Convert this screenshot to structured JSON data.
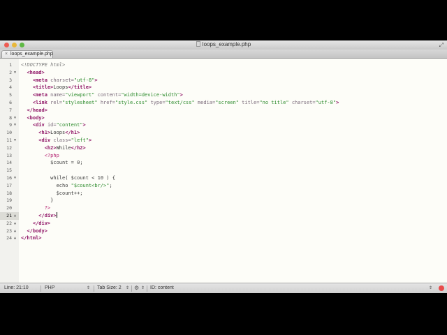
{
  "window": {
    "title": "loops_example.php",
    "tab_label": "loops_example.php"
  },
  "editor": {
    "current_line": 21,
    "lines": [
      {
        "n": "1",
        "fold": "",
        "html": "<span class=\"cm\">&lt;!DOCTYPE html&gt;</span>"
      },
      {
        "n": "2",
        "fold": "▼",
        "html": "  <span class=\"tg\">&lt;head&gt;</span>"
      },
      {
        "n": "3",
        "fold": "",
        "html": "    <span class=\"tg\">&lt;meta</span> <span class=\"at\">charset=</span><span class=\"str\">\"utf-8\"</span><span class=\"tg\">&gt;</span>"
      },
      {
        "n": "4",
        "fold": "",
        "html": "    <span class=\"tg\">&lt;title&gt;</span>Loops<span class=\"tg\">&lt;/title&gt;</span>"
      },
      {
        "n": "5",
        "fold": "",
        "html": "    <span class=\"tg\">&lt;meta</span> <span class=\"at\">name=</span><span class=\"str\">\"viewport\"</span> <span class=\"at\">content=</span><span class=\"str\">\"width=device-width\"</span><span class=\"tg\">&gt;</span>"
      },
      {
        "n": "6",
        "fold": "",
        "html": "    <span class=\"tg\">&lt;link</span> <span class=\"at\">rel=</span><span class=\"str\">\"stylesheet\"</span> <span class=\"at\">href=</span><span class=\"str\">\"style.css\"</span> <span class=\"at\">type=</span><span class=\"str\">\"text/css\"</span> <span class=\"at\">media=</span><span class=\"str\">\"screen\"</span> <span class=\"at\">title=</span><span class=\"str\">\"no title\"</span> <span class=\"at\">charset=</span><span class=\"str\">\"utf-8\"</span><span class=\"tg\">&gt;</span>"
      },
      {
        "n": "7",
        "fold": "",
        "html": "  <span class=\"tg\">&lt;/head&gt;</span>"
      },
      {
        "n": "8",
        "fold": "▼",
        "html": "  <span class=\"tg\">&lt;body&gt;</span>"
      },
      {
        "n": "9",
        "fold": "▼",
        "html": "    <span class=\"tg\">&lt;div</span> <span class=\"at\">id=</span><span class=\"str\">\"content\"</span><span class=\"tg\">&gt;</span>"
      },
      {
        "n": "10",
        "fold": "",
        "html": "      <span class=\"tg\">&lt;h1&gt;</span>Loops<span class=\"tg\">&lt;/h1&gt;</span>"
      },
      {
        "n": "11",
        "fold": "▼",
        "html": "      <span class=\"tg\">&lt;div</span> <span class=\"at\">class=</span><span class=\"str\">\"left\"</span><span class=\"tg\">&gt;</span>"
      },
      {
        "n": "12",
        "fold": "",
        "html": "        <span class=\"tg\">&lt;h2&gt;</span>While<span class=\"tg\">&lt;/h2&gt;</span>"
      },
      {
        "n": "13",
        "fold": "",
        "html": "        <span class=\"ph\">&lt;?php</span>"
      },
      {
        "n": "14",
        "fold": "",
        "html": "          <span class=\"vr\">$count</span> = <span class=\"vr\">0</span>;"
      },
      {
        "n": "15",
        "fold": "",
        "html": ""
      },
      {
        "n": "16",
        "fold": "▼",
        "html": "          <span class=\"fn\">while</span>( <span class=\"vr\">$count</span> &lt; <span class=\"vr\">10</span> ) {"
      },
      {
        "n": "17",
        "fold": "",
        "html": "            <span class=\"fn\">echo</span> <span class=\"str\">\"$count&lt;br/&gt;\"</span>;"
      },
      {
        "n": "18",
        "fold": "",
        "html": "            <span class=\"vr\">$count</span>++;"
      },
      {
        "n": "19",
        "fold": "",
        "html": "          }"
      },
      {
        "n": "20",
        "fold": "",
        "html": "        <span class=\"ph\">?&gt;</span>"
      },
      {
        "n": "21",
        "fold": "▲",
        "html": "      <span class=\"tg\">&lt;/div&gt;</span><span class=\"caret\"></span>"
      },
      {
        "n": "22",
        "fold": "▲",
        "html": "    <span class=\"tg\">&lt;/div&gt;</span>"
      },
      {
        "n": "23",
        "fold": "▲",
        "html": "  <span class=\"tg\">&lt;/body&gt;</span>"
      },
      {
        "n": "24",
        "fold": "▲",
        "html": "<span class=\"tg\">&lt;/html&gt;</span>"
      }
    ]
  },
  "status": {
    "position": "Line: 21:10",
    "syntax": "PHP",
    "tab_size": "Tab Size: 2",
    "symbol": "ID: content"
  },
  "colors": {
    "tag": "#8f1466",
    "string": "#2a8a2a",
    "background": "#fdfdf8"
  }
}
